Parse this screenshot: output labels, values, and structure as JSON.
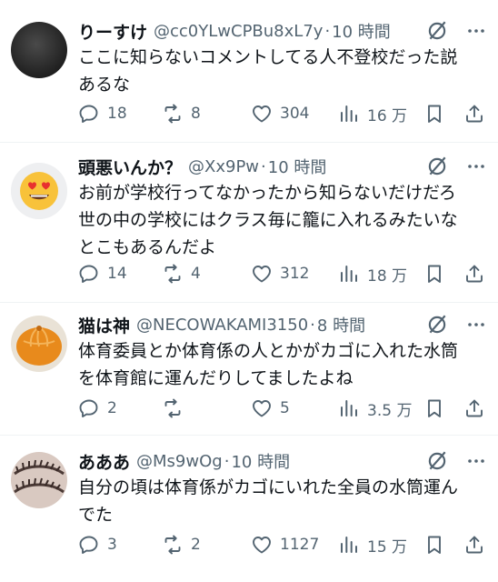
{
  "tweets": [
    {
      "name": "りーすけ",
      "handle": "@cc0YLwCPBu8xL7y",
      "time": "10 時間",
      "text": "ここに知らないコメントしてる人不登校だった説\nあるな",
      "replies": "18",
      "retweets": "8",
      "likes": "304",
      "views": "16 万",
      "avatar": "dark-circle-avatar"
    },
    {
      "name": "頭悪いんか？",
      "handle": "@Xx9Pw",
      "time": "10 時間",
      "text": "お前が学校行ってなかったから知らないだけだろ\n世の中の学校にはクラス毎に籠に入れるみたいな\nとこもあるんだよ",
      "replies": "14",
      "retweets": "4",
      "likes": "312",
      "views": "18 万",
      "avatar": "heart-eyes-emoji-avatar"
    },
    {
      "name": "猫は神",
      "handle": "@NECOWAKAMI3150",
      "time": "8 時間",
      "text": "体育委員とか体育係の人とかがカゴに入れた水筒\nを体育館に運んだりしてましたよね",
      "replies": "2",
      "retweets": "",
      "likes": "5",
      "views": "3.5 万",
      "avatar": "mandarin-orange-avatar"
    },
    {
      "name": "あああ",
      "handle": "@Ms9wOg",
      "time": "10 時間",
      "text": "自分の頃は体育係がカゴにいれた全員の水筒運ん\nでた",
      "replies": "3",
      "retweets": "2",
      "likes": "1127",
      "views": "15 万",
      "avatar": "eyelashes-avatar"
    }
  ],
  "dot_separator": "·",
  "colors": {
    "text": "#0f1419",
    "muted": "#536471",
    "divider": "#eff3f4"
  }
}
